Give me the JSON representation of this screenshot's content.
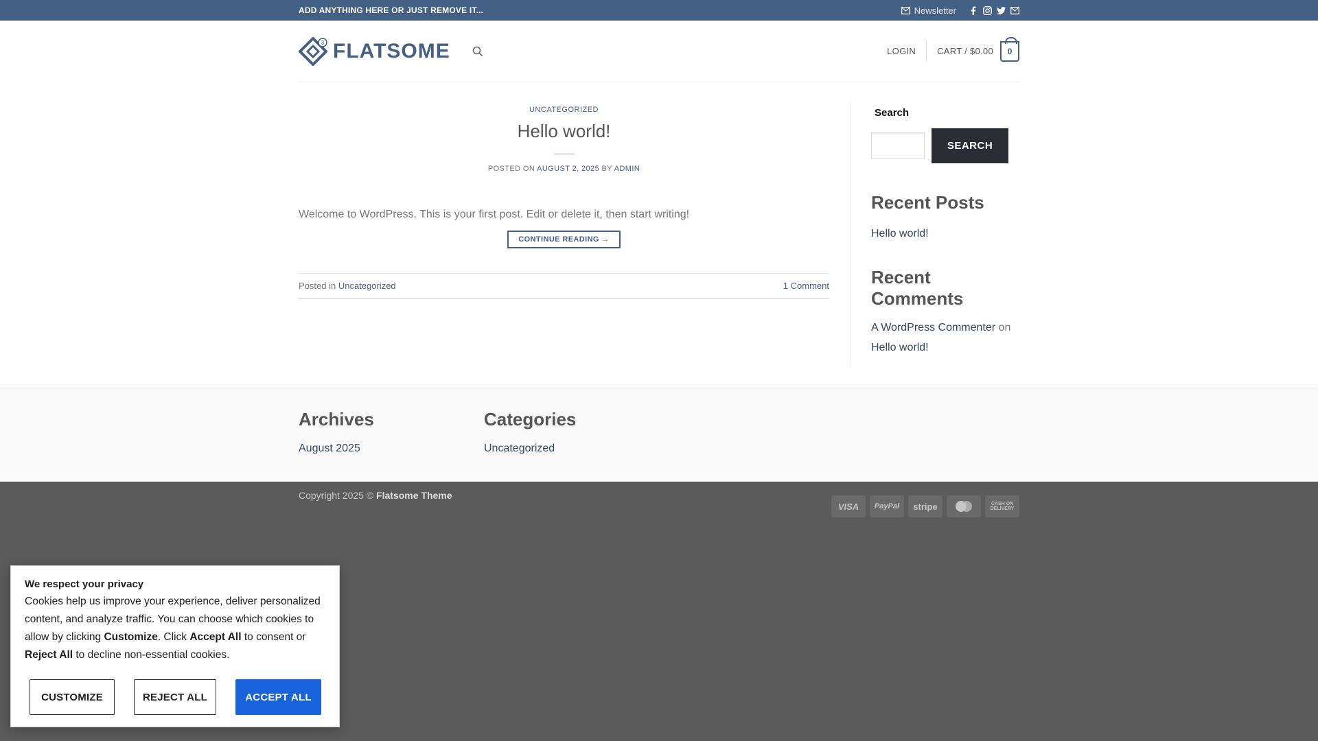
{
  "topbar": {
    "announcement": "ADD ANYTHING HERE OR JUST REMOVE IT...",
    "newsletter_label": "Newsletter",
    "social": [
      "facebook-icon",
      "instagram-icon",
      "twitter-icon",
      "email-icon"
    ]
  },
  "header": {
    "logo_text": "FLATSOME",
    "login_label": "LOGIN",
    "cart_label": "CART / $0.00",
    "cart_count": "0"
  },
  "post": {
    "category": "UNCATEGORIZED",
    "title": "Hello world!",
    "meta_prefix": "POSTED ON ",
    "date": "AUGUST 2, 2025",
    "meta_by": " BY ",
    "author": "ADMIN",
    "excerpt": "Welcome to WordPress. This is your first post. Edit or delete it, then start writing!",
    "continue_label": "CONTINUE READING →",
    "posted_in_label": "Posted in ",
    "posted_in_category": "Uncategorized",
    "comments_label": "1 Comment"
  },
  "sidebar": {
    "search_label": "Search",
    "search_button": "SEARCH",
    "recent_posts_title": "Recent Posts",
    "recent_posts": [
      "Hello world!"
    ],
    "recent_comments_title": "Recent Comments",
    "comment_author": "A WordPress Commenter",
    "comment_on": " on ",
    "comment_post": "Hello world!"
  },
  "footer_widgets": {
    "archives_title": "Archives",
    "archives_item": "August 2025",
    "categories_title": "Categories",
    "categories_item": "Uncategorized"
  },
  "footer": {
    "copyright_prefix": "Copyright 2025 © ",
    "copyright_brand": "Flatsome Theme",
    "payments": [
      "VISA",
      "PayPal",
      "stripe",
      "mastercard",
      "CASH ON DELIVERY"
    ]
  },
  "cookie": {
    "title": "We respect your privacy",
    "body_1": "Cookies help us improve your experience, deliver personalized content, and analyze traffic. You can choose which cookies to allow by clicking ",
    "body_customize": "Customize",
    "body_2": ". Click ",
    "body_accept": "Accept All",
    "body_3": " to consent or ",
    "body_reject": "Reject All",
    "body_4": " to decline non-essential cookies.",
    "customize_label": "CUSTOMIZE",
    "reject_label": "REJECT ALL",
    "accept_label": "ACCEPT ALL"
  },
  "colors": {
    "primary": "#446084",
    "topbar_bg": "#446084",
    "footer_bg": "#5b5b5b",
    "accept_button": "#1863dc",
    "search_button": "#2b2d35"
  }
}
